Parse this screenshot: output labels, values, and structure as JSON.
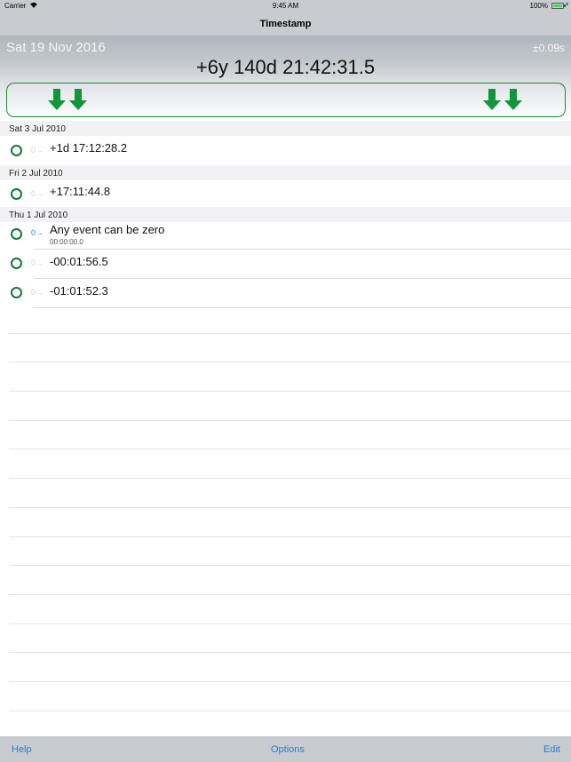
{
  "status_bar": {
    "carrier": "Carrier",
    "time": "9:45 AM",
    "battery": "100%"
  },
  "nav": {
    "title": "Timestamp"
  },
  "header": {
    "current_date": "Sat 19 Nov 2016",
    "precision": "±0.09s",
    "elapsed": "+6y 140d 21:42:31.5",
    "accent_color": "#1a8a3a"
  },
  "sections": [
    {
      "date": "Sat 3 Jul 2010",
      "rows": [
        {
          "zero": "0→",
          "value": "+1d 17:12:28.2"
        }
      ]
    },
    {
      "date": "Fri 2 Jul 2010",
      "rows": [
        {
          "zero": "0→",
          "value": "+17:11:44.8"
        }
      ]
    },
    {
      "date": "Thu 1 Jul 2010",
      "rows": [
        {
          "zero": "0→",
          "value": "Any event can be zero",
          "sub": "00:00:00.0"
        },
        {
          "zero": "0→",
          "value": "-00:01:56.5"
        },
        {
          "zero": "0→",
          "value": "-01:01:52.3"
        }
      ]
    }
  ],
  "toolbar": {
    "help": "Help",
    "options": "Options",
    "edit": "Edit"
  }
}
